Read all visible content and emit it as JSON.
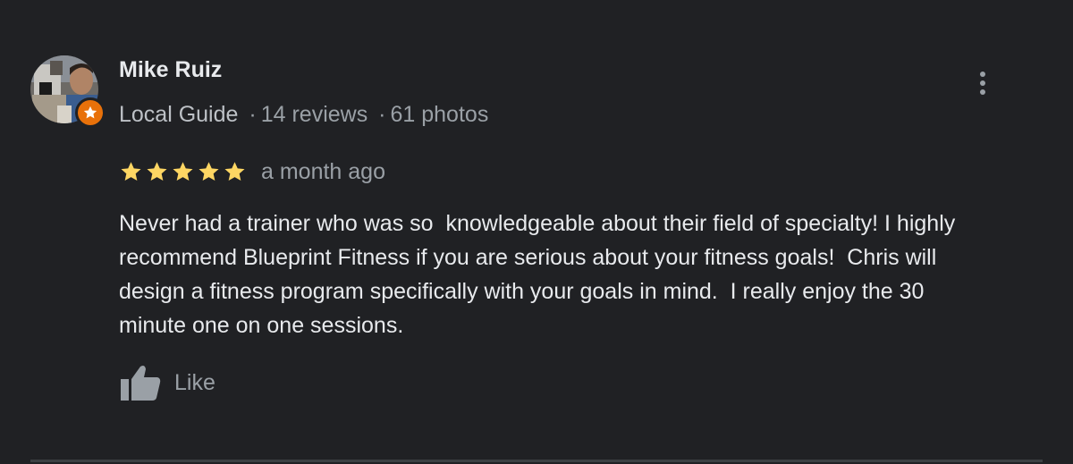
{
  "review": {
    "reviewer_name": "Mike Ruiz",
    "reviewer_level": "Local Guide",
    "separator": "·",
    "review_count": "14 reviews",
    "photo_count": "61 photos",
    "rating": 5,
    "date": "a month ago",
    "text": "Never had a trainer who was so  knowledgeable about their field of specialty! I highly\nrecommend Blueprint Fitness if you are serious about your fitness goals!  Chris will\ndesign a fitness program specifically with your goals in mind.  I really enjoy the 30\nminute one on one sessions.",
    "like_label": "Like"
  },
  "icons": {
    "avatar": "avatar-photo",
    "badge": "local-guide-star-icon",
    "more": "more-vertical-icon",
    "star": "star-icon",
    "like": "thumbs-up-icon"
  },
  "colors": {
    "background": "#202124",
    "star": "#fdd663",
    "badge": "#e8710a",
    "primary_text": "#e8eaed",
    "secondary_text": "#9aa0a6",
    "divider": "#3c4043"
  }
}
